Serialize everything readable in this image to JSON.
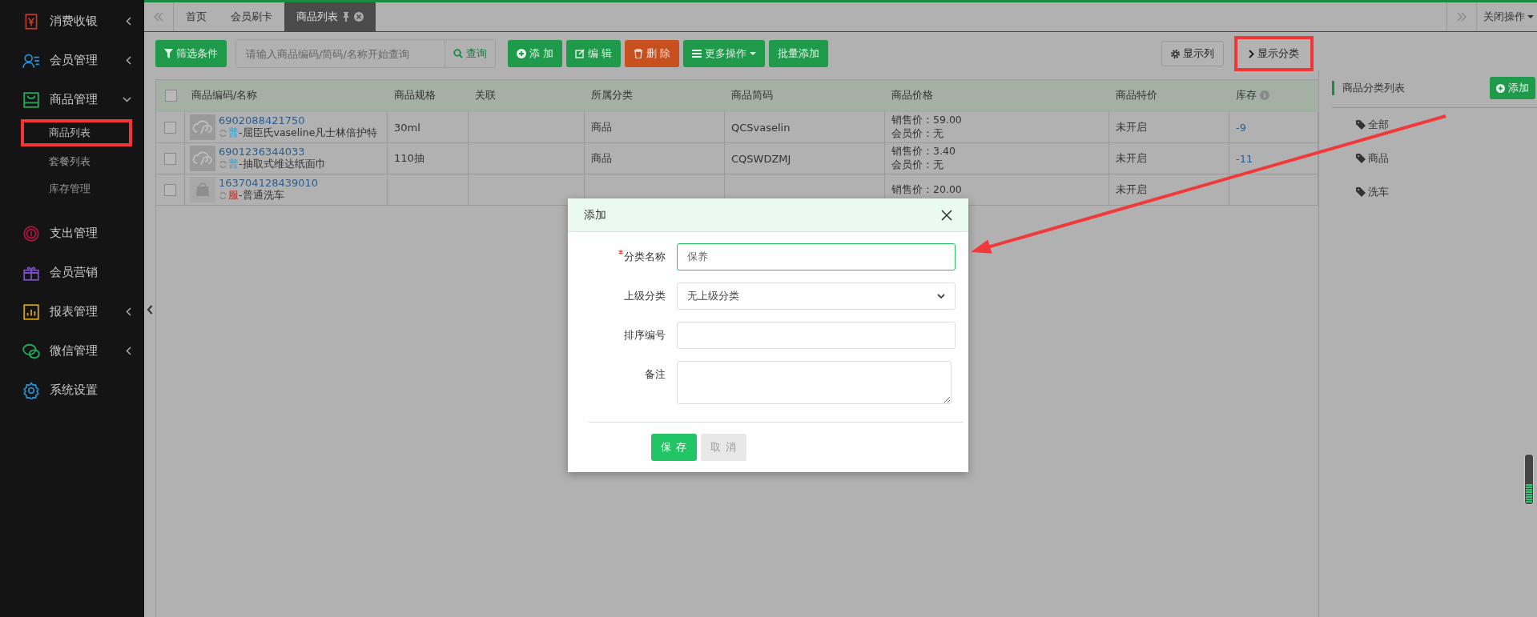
{
  "sidebar": {
    "items": [
      {
        "label": "消费收银",
        "color": "#c0392b",
        "kind": "group",
        "expanded": false
      },
      {
        "label": "会员管理",
        "color": "#2a8fd0",
        "kind": "group",
        "expanded": false
      },
      {
        "label": "商品管理",
        "color": "#1fae5c",
        "kind": "group",
        "expanded": true,
        "children": [
          {
            "label": "商品列表",
            "selected": true,
            "highlighted": true
          },
          {
            "label": "套餐列表",
            "selected": false,
            "highlighted": false
          },
          {
            "label": "库存管理",
            "selected": false,
            "highlighted": false
          }
        ]
      },
      {
        "label": "支出管理",
        "color": "#b0163f",
        "kind": "link"
      },
      {
        "label": "会员营销",
        "color": "#7b4fc9",
        "kind": "link"
      },
      {
        "label": "报表管理",
        "color": "#d6a41c",
        "kind": "group",
        "expanded": false
      },
      {
        "label": "微信管理",
        "color": "#1fae5c",
        "kind": "group",
        "expanded": false
      },
      {
        "label": "系统设置",
        "color": "#2a8fd0",
        "kind": "link"
      }
    ]
  },
  "tabs": [
    {
      "label": "首页",
      "selected": false
    },
    {
      "label": "会员刷卡",
      "selected": false
    },
    {
      "label": "商品列表",
      "selected": true
    }
  ],
  "close_menu": "关闭操作",
  "toolbar": {
    "filter": "筛选条件",
    "search": {
      "placeholder": "请输入商品编码/简码/名称开始查询",
      "button": "查询"
    },
    "actions": [
      {
        "label": "添 加",
        "kind": "primary"
      },
      {
        "label": "编 辑",
        "kind": "primary"
      },
      {
        "label": "删 除",
        "kind": "danger"
      },
      {
        "label": "更多操作",
        "kind": "dropdown"
      },
      {
        "label": "批量添加",
        "kind": "plain"
      }
    ],
    "right": [
      {
        "label": "显示列",
        "highlighted": false
      },
      {
        "label": "显示分类",
        "highlighted": true
      }
    ]
  },
  "table": {
    "all_checked": false,
    "columns": [
      "商品编码/名称",
      "商品规格",
      "关联",
      "所属分类",
      "商品简码",
      "商品价格",
      "商品特价",
      "库存"
    ],
    "rows": [
      {
        "checked": false,
        "kind": "product",
        "code": "6902088421750",
        "tag": "普",
        "color": "#2a9fd6",
        "name": "-屈臣氏vaseline凡士林倍护特",
        "spec": "30ml",
        "category": "商品",
        "short_code": "QCSvaselin",
        "sale_price": "销售价：59.00",
        "member_price": "会员价：无",
        "special": "未开启",
        "stock": "-9"
      },
      {
        "checked": false,
        "kind": "product",
        "code": "6901236344033",
        "tag": "普",
        "color": "#2a9fd6",
        "name": "-抽取式维达纸面巾",
        "spec": "110抽",
        "category": "商品",
        "short_code": "CQSWDZMJ",
        "sale_price": "销售价：3.40",
        "member_price": "会员价：无",
        "special": "未开启",
        "stock": "-11"
      },
      {
        "checked": false,
        "kind": "service",
        "code": "163704128439010",
        "tag": "服",
        "color": "#d0201a",
        "name": "-普通洗车",
        "sale_price": "销售价：20.00",
        "special": "未开启"
      }
    ]
  },
  "category_panel": {
    "title": "商品分类列表",
    "add": "添加",
    "items": [
      "全部",
      "商品",
      "洗车"
    ]
  },
  "dialog": {
    "title": "添加",
    "fields": [
      {
        "label": "分类名称",
        "required": true,
        "kind": "text",
        "value": "保养",
        "focused": true
      },
      {
        "label": "上级分类",
        "required": false,
        "kind": "select",
        "value": "无上级分类",
        "focused": false
      },
      {
        "label": "排序编号",
        "required": false,
        "kind": "text",
        "focused": false
      },
      {
        "label": "备注",
        "required": false,
        "kind": "textarea",
        "focused": false
      }
    ],
    "buttons": [
      {
        "label": "保 存",
        "kind": "primary"
      },
      {
        "label": "取 消",
        "kind": "secondary"
      }
    ]
  }
}
